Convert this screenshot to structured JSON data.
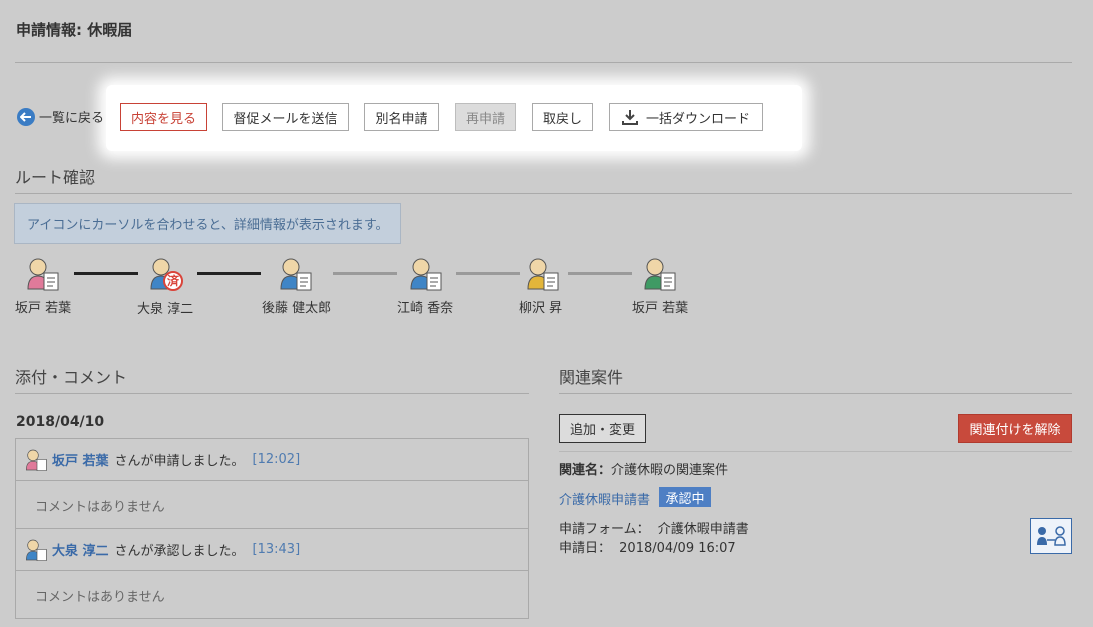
{
  "page": {
    "title": "申請情報: 休暇届"
  },
  "toolbar": {
    "back_label": "一覧に戻る",
    "view_label": "内容を見る",
    "remind_label": "督促メールを送信",
    "alias_label": "別名申請",
    "reapply_label": "再申請",
    "withdraw_label": "取戻し",
    "download_label": "一括ダウンロード"
  },
  "route": {
    "title": "ルート確認",
    "info": "アイコンにカーソルを合わせると、詳細情報が表示されます。",
    "approved_stamp": "済",
    "people": [
      {
        "name": "坂戸 若葉",
        "color": "#e07a9a"
      },
      {
        "name": "大泉 淳二",
        "color": "#3f85c6"
      },
      {
        "name": "後藤 健太郎",
        "color": "#3f85c6"
      },
      {
        "name": "江崎 香奈",
        "color": "#3f85c6"
      },
      {
        "name": "柳沢 昇",
        "color": "#e2b53a"
      },
      {
        "name": "坂戸 若葉",
        "color": "#3f9a64"
      }
    ]
  },
  "attachments": {
    "title": "添付・コメント",
    "date": "2018/04/10",
    "entries": [
      {
        "user": "坂戸 若葉",
        "action": "さんが申請しました。",
        "time": "[12:02]",
        "comment": "コメントはありません",
        "color": "#e07a9a"
      },
      {
        "user": "大泉 淳二",
        "action": "さんが承認しました。",
        "time": "[13:43]",
        "comment": "コメントはありません",
        "color": "#3f85c6"
      }
    ]
  },
  "related": {
    "title": "関連案件",
    "add_label": "追加・変更",
    "unlink_label": "関連付けを解除",
    "name_label": "関連名：",
    "name_value": "介護休暇の関連案件",
    "link_text": "介護休暇申請書",
    "status": "承認中",
    "form_label": "申請フォーム：",
    "form_value": "介護休暇申請書",
    "date_label": "申請日：",
    "date_value": "2018/04/09 16:07"
  },
  "colors": {
    "accent_red": "#c84236",
    "link_blue": "#3a6aa8",
    "status_blue": "#4e7fc4"
  }
}
